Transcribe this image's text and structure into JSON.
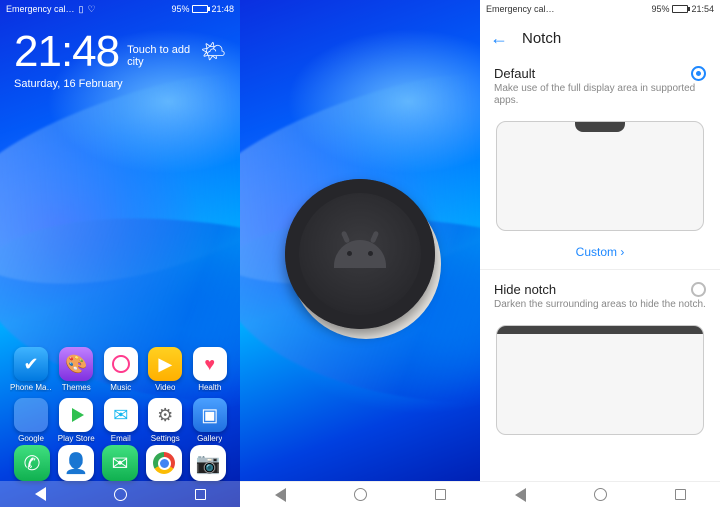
{
  "status": {
    "left_text": "Emergency cal…",
    "battery_pct": "95%",
    "time_left_panel": "21:48",
    "time_right_panel": "21:54",
    "battery_fill_pct": 95
  },
  "home": {
    "clock_time": "21:48",
    "touch_city": "Touch to add city",
    "date": "Saturday, 16 February",
    "weather_icon": "partly-cloudy",
    "apps": [
      {
        "name": "phone-manager",
        "label": "Phone Ma…",
        "icon": "shield",
        "glyph": "✔"
      },
      {
        "name": "themes",
        "label": "Themes",
        "icon": "themes",
        "glyph": "🎨"
      },
      {
        "name": "music",
        "label": "Music",
        "icon": "music",
        "glyph": ""
      },
      {
        "name": "video",
        "label": "Video",
        "icon": "video",
        "glyph": "▶"
      },
      {
        "name": "health",
        "label": "Health",
        "icon": "health",
        "glyph": "♥"
      },
      {
        "name": "google-folder",
        "label": "Google",
        "icon": "folder",
        "glyph": ""
      },
      {
        "name": "play-store",
        "label": "Play Store",
        "icon": "play",
        "glyph": ""
      },
      {
        "name": "email",
        "label": "Email",
        "icon": "email",
        "glyph": "✉"
      },
      {
        "name": "settings",
        "label": "Settings",
        "icon": "settings",
        "glyph": "⚙"
      },
      {
        "name": "gallery",
        "label": "Gallery",
        "icon": "gallery",
        "glyph": "▣"
      }
    ],
    "dock": [
      {
        "name": "dialer",
        "icon": "phone",
        "glyph": "✆"
      },
      {
        "name": "contacts",
        "icon": "contacts",
        "glyph": "👤"
      },
      {
        "name": "messages",
        "icon": "message",
        "glyph": "✉"
      },
      {
        "name": "chrome",
        "icon": "chrome",
        "glyph": ""
      },
      {
        "name": "camera",
        "icon": "camera",
        "glyph": "📷"
      }
    ]
  },
  "settings": {
    "title": "Notch",
    "options": [
      {
        "title": "Default",
        "subtitle": "Make use of the full display area in supported apps.",
        "checked": true
      },
      {
        "title": "Hide notch",
        "subtitle": "Darken the surrounding areas to hide the notch.",
        "checked": false
      }
    ],
    "custom_label": "Custom"
  },
  "colors": {
    "accent": "#1e88ff"
  }
}
